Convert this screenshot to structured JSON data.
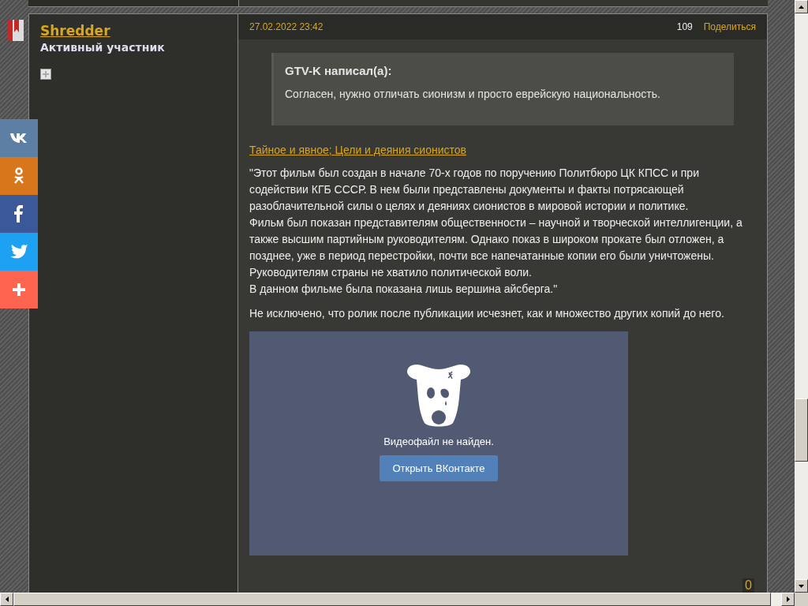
{
  "share_bar": [
    {
      "kind": "vk"
    },
    {
      "kind": "ok"
    },
    {
      "kind": "fb"
    },
    {
      "kind": "tw"
    },
    {
      "kind": "more"
    }
  ],
  "author": {
    "name": "Shredder",
    "title": "Активный участник"
  },
  "post": {
    "date": "27.02.2022 23:42",
    "number": "109",
    "share": "Поделиться",
    "quote": {
      "author": "GTV-K написал(а):",
      "text": "Согласен, нужно отличать сионизм и просто еврейскую национальность."
    },
    "link": "Тайное и явное; Цели и деяния сионистов",
    "paragraphs": [
      "\"Этот фильм был создан в начале 70-х годов по поручению Политбюро ЦК КПСС и при\nсодействии КГБ СССР. В нем были представлены документы и факты потрясающей\nразоблачительной силы о целях и деяниях сионистов в мировой истории и политике.\nФильм был показан представителям общественности – научной и творческой интеллигенции, а\nтакже высшим партийным руководителям. Однако показ в широком прокате был отложен, а\nпозднее, уже в период перестройки, почти все напечатанные копии его были уничтожены.\nРуководителям страны не хватило политической воли.\nВ данном фильме была показана лишь вершина айсберга.\"",
      "Не исключено, что ролик после публикации исчезнет, как и множество других копий до него."
    ],
    "video": {
      "message": "Видеофайл не найден.",
      "button": "Открыть ВКонтакте"
    },
    "likes": "0"
  }
}
